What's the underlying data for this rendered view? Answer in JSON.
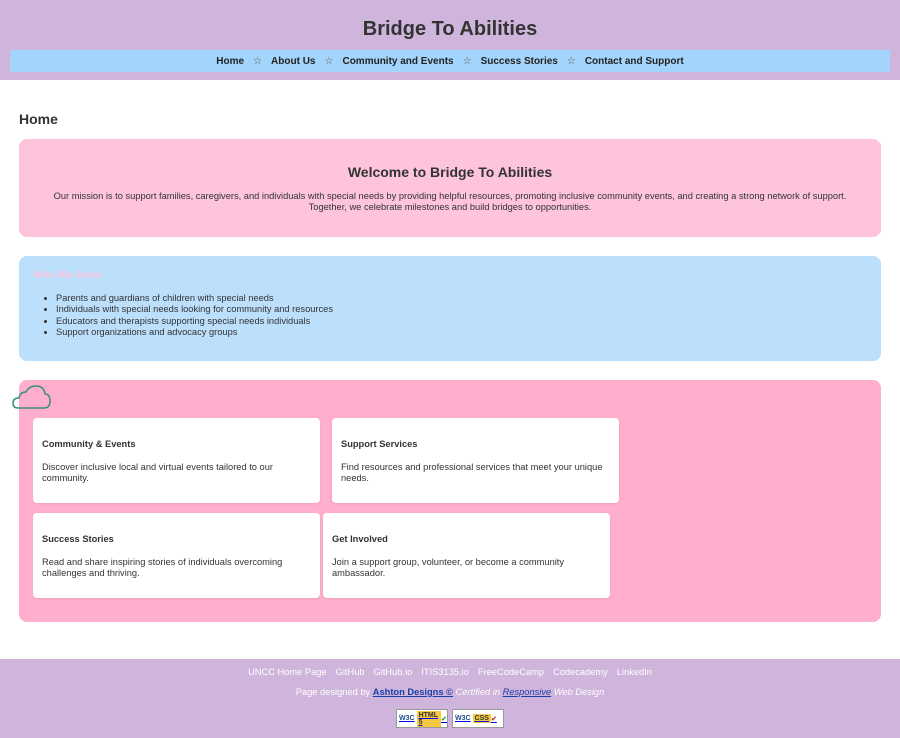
{
  "site": {
    "title": "Bridge To Abilities"
  },
  "nav": {
    "items": [
      "Home",
      "About Us",
      "Community and Events",
      "Success Stories",
      "Contact and Support"
    ],
    "separator": "☆"
  },
  "page": {
    "heading": "Home"
  },
  "welcome": {
    "title": "Welcome to Bridge To Abilities",
    "text": "Our mission is to support families, caregivers, and individuals with special needs by providing helpful resources, promoting inclusive community events, and creating a strong network of support. Together, we celebrate milestones and build bridges to opportunities."
  },
  "serve": {
    "title": "Who We Serve",
    "items": [
      "Parents and guardians of children with special needs",
      "Individuals with special needs looking for community and resources",
      "Educators and therapists supporting special needs individuals",
      "Support organizations and advocacy groups"
    ]
  },
  "features": {
    "cards": [
      {
        "title": "Community & Events",
        "text": "Discover inclusive local and virtual events tailored to our community."
      },
      {
        "title": "Support Services",
        "text": "Find resources and professional services that meet your unique needs."
      },
      {
        "title": "Success Stories",
        "text": "Read and share inspiring stories of individuals overcoming challenges and thriving."
      },
      {
        "title": "Get Involved",
        "text": "Join a support group, volunteer, or become a community ambassador."
      }
    ]
  },
  "footer": {
    "links": [
      "UNCC Home Page",
      "GitHub",
      "GitHub.io",
      "ITIS3135.io",
      "FreeCodeCamp",
      "Codecademy",
      "LinkedIn"
    ],
    "designed_by_prefix": "Page designed by",
    "designer": "Ashton Designs ©",
    "certified_prefix": "Certified in",
    "responsive": "Responsive",
    "certified_suffix": "Web Design",
    "badges": [
      {
        "logo": "W3C",
        "kind": "HTML 5"
      },
      {
        "logo": "W3C",
        "kind": "CSS"
      }
    ]
  },
  "colors": {
    "header": "#cfb4dc",
    "nav": "#a3d4fb",
    "welcome": "#fdc4dc",
    "serve": "#bcdffc",
    "features": "#ffaece"
  }
}
